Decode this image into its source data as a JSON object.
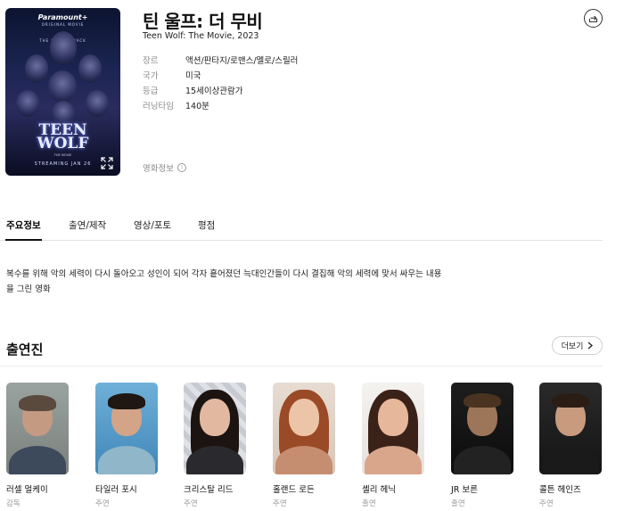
{
  "movie": {
    "title_ko": "틴 울프: 더 무비",
    "title_en": "Teen Wolf: The Movie, 2023",
    "poster": {
      "brand": "Paramount+",
      "brand_sub": "ORIGINAL MOVIE",
      "tagline": "THE PACK IS BACK",
      "title_line1": "TEEN",
      "title_line2": "WOLF",
      "title_sub": "THE MOVIE",
      "streaming": "STREAMING JAN 26"
    },
    "meta": [
      {
        "label": "장르",
        "value": "액션/판타지/로맨스/멜로/스릴러"
      },
      {
        "label": "국가",
        "value": "미국"
      },
      {
        "label": "등급",
        "value": "15세이상관람가"
      },
      {
        "label": "러닝타임",
        "value": "140분"
      }
    ],
    "movie_info_label": "영화정보",
    "info_icon_symbol": "!"
  },
  "tabs": [
    {
      "label": "주요정보",
      "active": true
    },
    {
      "label": "출연/제작",
      "active": false
    },
    {
      "label": "영상/포토",
      "active": false
    },
    {
      "label": "평점",
      "active": false
    }
  ],
  "synopsis": "복수를 위해 악의 세력이 다시 돌아오고 성인이 되어 각자 흩어졌던 늑대인간들이 다시 결집해 악의 세력에 맞서 싸우는 내용을 그린 영화",
  "cast_section": {
    "title": "출연진",
    "more_label": "더보기",
    "members": [
      {
        "name": "러셀 멀케이",
        "role": "감독"
      },
      {
        "name": "타일러 포시",
        "role": "주연"
      },
      {
        "name": "크리스탈 리드",
        "role": "주연"
      },
      {
        "name": "홀랜드 로든",
        "role": "주연"
      },
      {
        "name": "셸리 헤닉",
        "role": "출연"
      },
      {
        "name": "JR 보른",
        "role": "출연"
      },
      {
        "name": "콜튼 헤인즈",
        "role": "주연"
      }
    ]
  },
  "icons": {
    "share": "share-icon",
    "expand": "expand-icon",
    "info": "info-icon",
    "chevron": "chevron-right-icon"
  },
  "colors": {
    "text": "#111111",
    "muted": "#8a8a8a",
    "divider": "#e3e3e3"
  }
}
